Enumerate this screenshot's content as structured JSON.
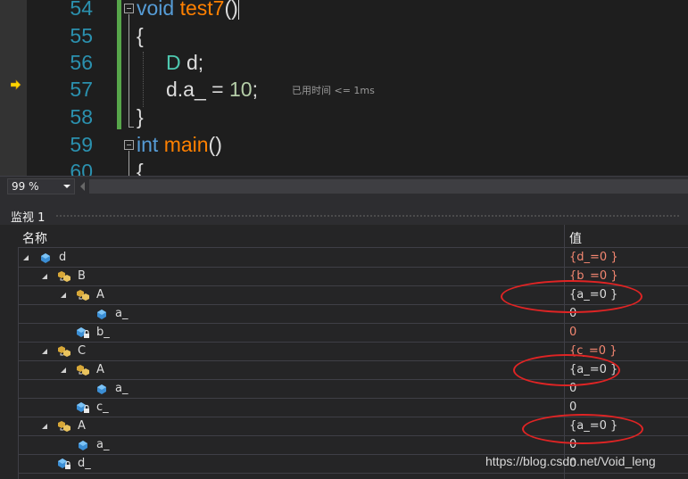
{
  "editor": {
    "lines": [
      {
        "num": "54",
        "tokens": [
          {
            "t": "void",
            "c": "kw"
          },
          {
            "t": " ",
            "c": "plain"
          },
          {
            "t": "test7",
            "c": "fn"
          },
          {
            "t": "()",
            "c": "plain"
          }
        ]
      },
      {
        "num": "55",
        "tokens": [
          {
            "t": "{",
            "c": "plain"
          }
        ]
      },
      {
        "num": "56",
        "tokens": [
          {
            "t": "D",
            "c": "ty"
          },
          {
            "t": " d;",
            "c": "plain"
          }
        ]
      },
      {
        "num": "57",
        "tokens": [
          {
            "t": "d.a_ = ",
            "c": "plain"
          },
          {
            "t": "10",
            "c": "num"
          },
          {
            "t": ";",
            "c": "plain"
          }
        ]
      },
      {
        "num": "58",
        "tokens": [
          {
            "t": "}",
            "c": "plain"
          }
        ]
      },
      {
        "num": "59",
        "tokens": [
          {
            "t": "int",
            "c": "kw"
          },
          {
            "t": " ",
            "c": "plain"
          },
          {
            "t": "main",
            "c": "fn"
          },
          {
            "t": "()",
            "c": "plain"
          }
        ]
      },
      {
        "num": "60",
        "tokens": [
          {
            "t": "{",
            "c": "plain"
          }
        ]
      }
    ],
    "perf_tip": "已用时间 <= 1ms",
    "current_line": "57"
  },
  "zoom": {
    "value": "99 %"
  },
  "watch": {
    "title": "监视 1",
    "columns": {
      "name": "名称",
      "value": "值"
    },
    "rows": [
      {
        "name": "d",
        "value": "{d_=0 }",
        "level": 0,
        "expand": true,
        "icon": "object-icon",
        "changed": true
      },
      {
        "name": "B",
        "value": "{b_=0 }",
        "level": 1,
        "expand": true,
        "icon": "base-class-icon",
        "changed": true
      },
      {
        "name": "A",
        "value": "{a_=0 }",
        "level": 2,
        "expand": true,
        "icon": "base-class-icon",
        "changed": false
      },
      {
        "name": "a_",
        "value": "0",
        "level": 3,
        "expand": false,
        "icon": "field-icon",
        "changed": false
      },
      {
        "name": "b_",
        "value": "0",
        "level": 2,
        "expand": false,
        "icon": "private-field-icon",
        "changed": true
      },
      {
        "name": "C",
        "value": "{c_=0 }",
        "level": 1,
        "expand": true,
        "icon": "base-class-icon",
        "changed": true
      },
      {
        "name": "A",
        "value": "{a_=0 }",
        "level": 2,
        "expand": true,
        "icon": "base-class-icon",
        "changed": false
      },
      {
        "name": "a_",
        "value": "0",
        "level": 3,
        "expand": false,
        "icon": "field-icon",
        "changed": false
      },
      {
        "name": "c_",
        "value": "0",
        "level": 2,
        "expand": false,
        "icon": "private-field-icon",
        "changed": false
      },
      {
        "name": "A",
        "value": "{a_=0 }",
        "level": 1,
        "expand": true,
        "icon": "base-class-icon",
        "changed": false
      },
      {
        "name": "a_",
        "value": "0",
        "level": 2,
        "expand": false,
        "icon": "field-icon",
        "changed": false
      },
      {
        "name": "d_",
        "value": "0",
        "level": 1,
        "expand": false,
        "icon": "private-field-icon",
        "changed": false
      }
    ]
  },
  "colors": {
    "accent_keyword": "#569cd6",
    "function": "#ff8000",
    "changed_value": "#f48771",
    "annotation": "#e02424"
  },
  "watermark": "https://blog.csdn.net/Void_leng"
}
